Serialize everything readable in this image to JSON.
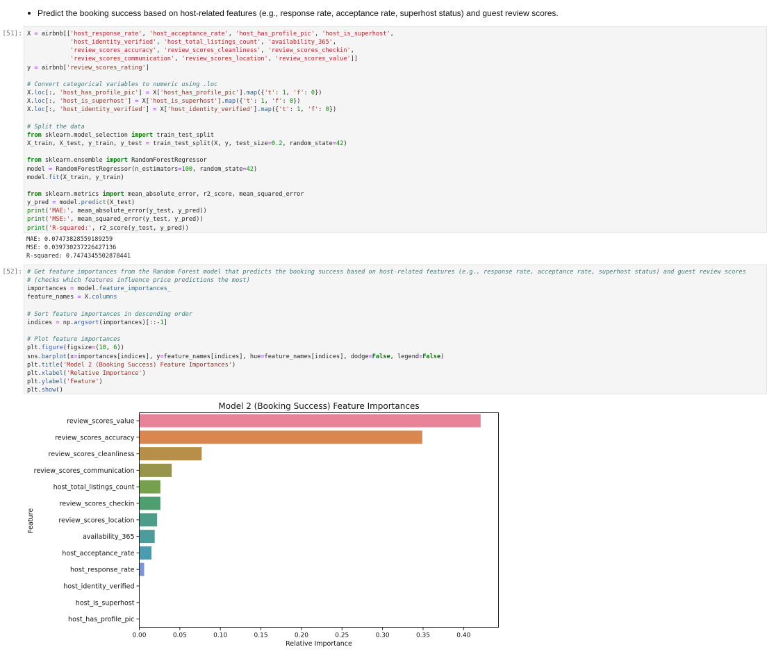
{
  "markdown": {
    "bullet_text": "Predict the booking success based on host-related features (e.g., response rate, acceptance rate, superhost status) and guest review scores."
  },
  "cells": [
    {
      "prompt": "[51]:",
      "lines": [
        "X = airbnb[['host_response_rate', 'host_acceptance_rate', 'host_has_profile_pic', 'host_is_superhost',",
        "            'host_identity_verified', 'host_total_listings_count', 'availability_365',",
        "            'review_scores_accuracy', 'review_scores_cleanliness', 'review_scores_checkin',",
        "            'review_scores_communication', 'review_scores_location', 'review_scores_value']]",
        "y = airbnb['review_scores_rating']",
        "",
        "# Convert categorical variables to numeric using .loc",
        "X.loc[:, 'host_has_profile_pic'] = X['host_has_profile_pic'].map({'t': 1, 'f': 0})",
        "X.loc[:, 'host_is_superhost'] = X['host_is_superhost'].map({'t': 1, 'f': 0})",
        "X.loc[:, 'host_identity_verified'] = X['host_identity_verified'].map({'t': 1, 'f': 0})",
        "",
        "# Split the data",
        "from sklearn.model_selection import train_test_split",
        "X_train, X_test, y_train, y_test = train_test_split(X, y, test_size=0.2, random_state=42)",
        "",
        "from sklearn.ensemble import RandomForestRegressor",
        "model = RandomForestRegressor(n_estimators=100, random_state=42)",
        "model.fit(X_train, y_train)",
        "",
        "from sklearn.metrics import mean_absolute_error, r2_score, mean_squared_error",
        "y_pred = model.predict(X_test)",
        "print('MAE:', mean_absolute_error(y_test, y_pred))",
        "print('MSE:', mean_squared_error(y_test, y_pred))",
        "print('R-squared:', r2_score(y_test, y_pred))"
      ],
      "output": [
        "MAE: 0.07473828559189259",
        "MSE: 0.039730237226427136",
        "R-squared: 0.7474345502878441"
      ]
    },
    {
      "prompt": "[52]:",
      "lines": [
        "# Get feature importances from the Random Forest model that predicts the booking success based on host-related features (e.g., response rate, acceptance rate, superhost status) and guest review scores",
        "# (checks which features influence price predictions the most)",
        "importances = model.feature_importances_",
        "feature_names = X.columns",
        "",
        "# Sort feature importances in descending order",
        "indices = np.argsort(importances)[::-1]",
        "",
        "# Plot feature importances",
        "plt.figure(figsize=(10, 6))",
        "sns.barplot(x=importances[indices], y=feature_names[indices], hue=feature_names[indices], dodge=False, legend=False)",
        "plt.title('Model 2 (Booking Success) Feature Importances')",
        "plt.xlabel('Relative Importance')",
        "plt.ylabel('Feature')",
        "plt.show()"
      ]
    }
  ],
  "chart_data": {
    "type": "bar",
    "orientation": "horizontal",
    "title": "Model 2 (Booking Success) Feature Importances",
    "xlabel": "Relative Importance",
    "ylabel": "Feature",
    "xlim": [
      0,
      0.443
    ],
    "xticks": [
      "0.00",
      "0.05",
      "0.10",
      "0.15",
      "0.20",
      "0.25",
      "0.30",
      "0.35",
      "0.40"
    ],
    "grid": false,
    "categories": [
      "review_scores_value",
      "review_scores_accuracy",
      "review_scores_cleanliness",
      "review_scores_communication",
      "host_total_listings_count",
      "review_scores_checkin",
      "review_scores_location",
      "availability_365",
      "host_acceptance_rate",
      "host_response_rate",
      "host_identity_verified",
      "host_is_superhost",
      "host_has_profile_pic"
    ],
    "values": [
      0.421,
      0.349,
      0.077,
      0.04,
      0.026,
      0.026,
      0.022,
      0.019,
      0.015,
      0.006,
      0.0005,
      0.0003,
      0.0001
    ],
    "colors": [
      "#e8849a",
      "#d98650",
      "#b88f49",
      "#98944c",
      "#75a14c",
      "#4f9e70",
      "#4d9d8a",
      "#4d9c9c",
      "#4a9db0",
      "#7b96d8",
      "#a48ee6",
      "#d480e3",
      "#e67fbf"
    ]
  }
}
